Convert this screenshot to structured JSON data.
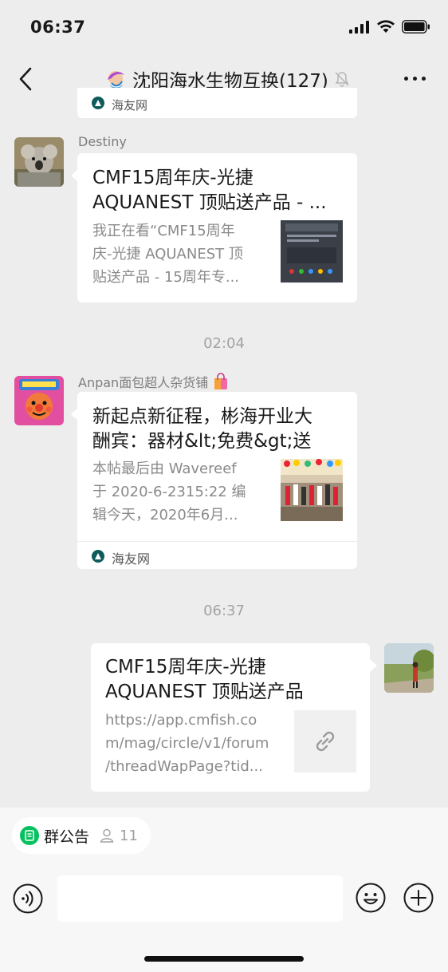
{
  "status_bar": {
    "time": "06:37"
  },
  "nav": {
    "title": "沈阳海水生物互换(127)"
  },
  "top_stub": {
    "source": "海友网"
  },
  "messages": [
    {
      "sender": "Destiny",
      "title_line1": "CMF15周年庆-光捷",
      "title_line2": "AQUANEST 顶贴送产品 - ...",
      "desc_line1": "我正在看“CMF15周年",
      "desc_line2": "庆-光捷 AQUANEST 顶",
      "desc_line3": "贴送产品 - 15周年专..."
    },
    {
      "timestamp": "02:04",
      "sender": "Anpan面包超人杂货铺",
      "title_line1": "新起点新征程，彬海开业大",
      "title_line2": "酬宾：器材&lt;免费&gt;送",
      "desc_line1": "本帖最后由 Wavereef",
      "desc_line2": "于 2020-6-2315:22 编",
      "desc_line3": "辑今天，2020年6月...",
      "source": "海友网"
    },
    {
      "timestamp": "06:37",
      "title_line1": "CMF15周年庆-光捷",
      "title_line2": "AQUANEST 顶贴送产品",
      "desc_line1": "https://app.cmfish.co",
      "desc_line2": "m/mag/circle/v1/forum",
      "desc_line3": "/threadWapPage?tid..."
    }
  ],
  "bottom_bar": {
    "notice_label": "群公告",
    "notice_count": "11"
  },
  "colors": {
    "background": "#ededed",
    "bubble": "#ffffff",
    "accent_green": "#07c160",
    "muted_text": "#8a8a8a"
  },
  "icons": [
    "back-icon",
    "mute-icon",
    "more-icon",
    "voice-icon",
    "emoji-icon",
    "plus-icon",
    "link-icon",
    "notice-icon",
    "person-icon",
    "source-logo-icon"
  ]
}
